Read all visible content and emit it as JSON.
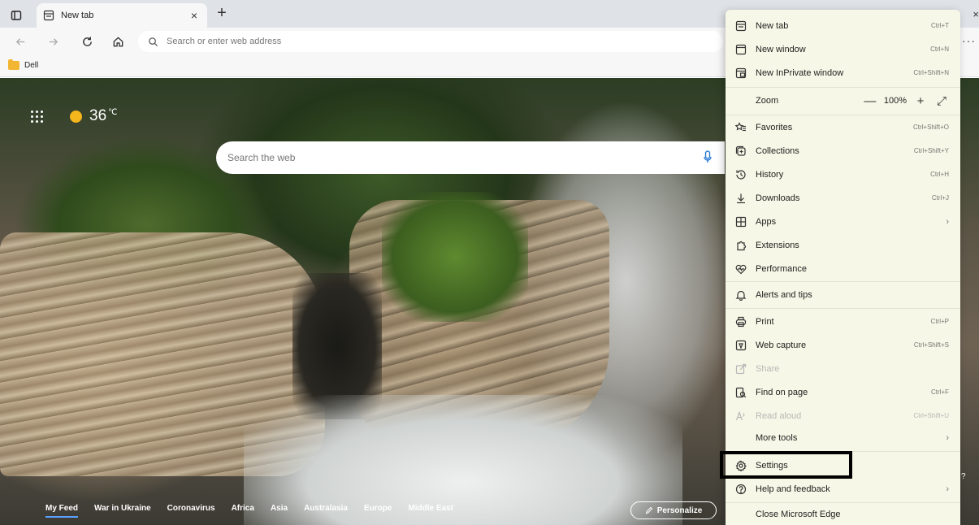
{
  "tab": {
    "title": "New tab",
    "close": "×",
    "new_tab": "+"
  },
  "window": {
    "close": "×"
  },
  "toolbar": {
    "address_placeholder": "Search or enter web address",
    "more": "···"
  },
  "favorites_bar": {
    "items": [
      {
        "label": "Dell"
      }
    ]
  },
  "ntp": {
    "temperature": "36",
    "temp_unit": "℃",
    "search_placeholder": "Search the web",
    "feed": [
      "My Feed",
      "War in Ukraine",
      "Coronavirus",
      "Africa",
      "Asia",
      "Australasia",
      "Europe",
      "Middle East"
    ],
    "personalize": "Personalize",
    "partial_text": "?"
  },
  "menu": {
    "items": [
      {
        "label": "New tab",
        "shortcut": "Ctrl+T",
        "icon": "new-tab-icon"
      },
      {
        "label": "New window",
        "shortcut": "Ctrl+N",
        "icon": "new-window-icon"
      },
      {
        "label": "New InPrivate window",
        "shortcut": "Ctrl+Shift+N",
        "icon": "inprivate-icon"
      },
      {
        "label": "Zoom",
        "zoom_value": "100%",
        "zoom_out": "—",
        "zoom_in": "+",
        "fullscreen": "⤢"
      },
      {
        "label": "Favorites",
        "shortcut": "Ctrl+Shift+O",
        "icon": "favorites-icon"
      },
      {
        "label": "Collections",
        "shortcut": "Ctrl+Shift+Y",
        "icon": "collections-icon"
      },
      {
        "label": "History",
        "shortcut": "Ctrl+H",
        "icon": "history-icon"
      },
      {
        "label": "Downloads",
        "shortcut": "Ctrl+J",
        "icon": "downloads-icon"
      },
      {
        "label": "Apps",
        "chevron": "›",
        "icon": "apps-icon"
      },
      {
        "label": "Extensions",
        "icon": "extensions-icon"
      },
      {
        "label": "Performance",
        "icon": "performance-icon"
      },
      {
        "label": "Alerts and tips",
        "icon": "alerts-icon"
      },
      {
        "label": "Print",
        "shortcut": "Ctrl+P",
        "icon": "print-icon"
      },
      {
        "label": "Web capture",
        "shortcut": "Ctrl+Shift+S",
        "icon": "web-capture-icon"
      },
      {
        "label": "Share",
        "icon": "share-icon",
        "disabled": true
      },
      {
        "label": "Find on page",
        "shortcut": "Ctrl+F",
        "icon": "find-icon"
      },
      {
        "label": "Read aloud",
        "shortcut": "Ctrl+Shift+U",
        "icon": "read-aloud-icon",
        "disabled": true
      },
      {
        "label": "More tools",
        "chevron": "›"
      },
      {
        "label": "Settings",
        "icon": "gear-icon"
      },
      {
        "label": "Help and feedback",
        "chevron": "›",
        "icon": "help-icon"
      },
      {
        "label": "Close Microsoft Edge"
      }
    ]
  }
}
